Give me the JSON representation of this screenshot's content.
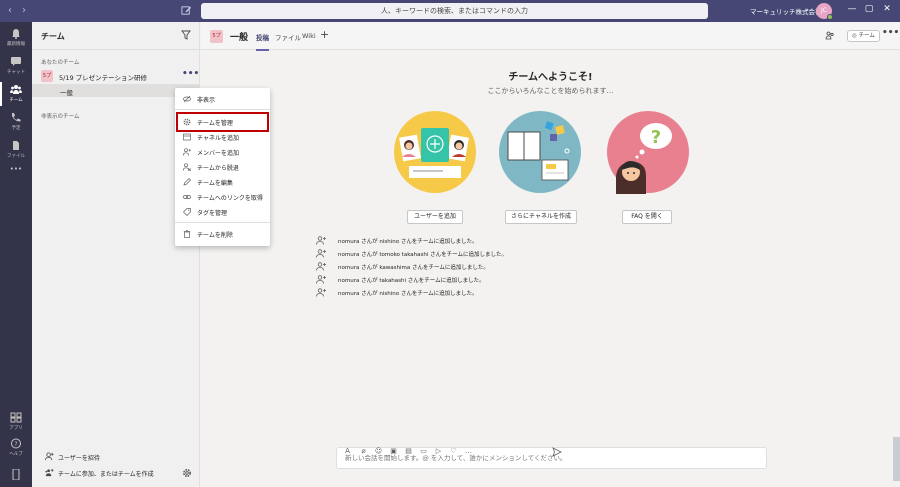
{
  "titlebar": {
    "search_placeholder": "人、キーワードの検索、またはコマンドの入力",
    "org_name": "マーキュリッチ株式会社",
    "org_chevron": "⌄",
    "avatar_initials": "JC",
    "back_glyph": "‹",
    "forward_glyph": "›",
    "minimize_glyph": "—",
    "maximize_glyph": "▢",
    "close_glyph": "✕"
  },
  "appbar": {
    "items": [
      {
        "label": "最新情報",
        "icon": "bell-icon"
      },
      {
        "label": "チャット",
        "icon": "chat-icon"
      },
      {
        "label": "チーム",
        "icon": "teams-icon"
      },
      {
        "label": "予定",
        "icon": "calendar-icon"
      },
      {
        "label": "ファイル",
        "icon": "file-icon"
      }
    ],
    "more_label": "•••",
    "apps_label": "アプリ",
    "help_label": "ヘルプ"
  },
  "teams_panel": {
    "title": "チーム",
    "your_teams_label": "あなたのチーム",
    "team_avatar": "5プ",
    "team_name": "5/19 プレゼンテーション研修",
    "team_more": "•••",
    "channel_name": "一般",
    "hidden_teams_label": "非表示のチーム",
    "invite_label": "ユーザーを招待",
    "join_create_label": "チームに参加、またはチームを作成"
  },
  "context_menu": {
    "items": [
      {
        "label": "非表示",
        "icon": "hide-icon"
      },
      {
        "label": "チームを管理",
        "icon": "gear-icon"
      },
      {
        "label": "チャネルを追加",
        "icon": "add-channel-icon"
      },
      {
        "label": "メンバーを追加",
        "icon": "add-member-icon"
      },
      {
        "label": "チームから脱退",
        "icon": "leave-icon"
      },
      {
        "label": "チームを編集",
        "icon": "edit-icon"
      },
      {
        "label": "チームへのリンクを取得",
        "icon": "link-icon"
      },
      {
        "label": "タグを管理",
        "icon": "tag-icon"
      },
      {
        "label": "チームを削除",
        "icon": "trash-icon"
      }
    ]
  },
  "channel": {
    "avatar": "5プ",
    "name": "一般",
    "tabs": [
      "投稿",
      "ファイル",
      "Wiki"
    ],
    "add_tab": "+",
    "team_pill": "◎ チーム",
    "more": "•••"
  },
  "welcome": {
    "title": "チームへようこそ!",
    "subtitle": "ここからいろんなことを始められます…",
    "buttons": [
      "ユーザーを追加",
      "さらにチャネルを作成",
      "FAQ を開く"
    ]
  },
  "activity": [
    {
      "actor": "nomura",
      "text": "nomura さんが nishino さんをチームに追加しました。"
    },
    {
      "actor": "nomura",
      "text": "nomura さんが tomoko takahashi さんをチームに追加しました。"
    },
    {
      "actor": "nomura",
      "text": "nomura さんが kawashima さんをチームに追加しました。"
    },
    {
      "actor": "nomura",
      "text": "nomura さんが takahashi さんをチームに追加しました。"
    },
    {
      "actor": "nomura",
      "text": "nomura さんが nishino さんをチームに追加しました。"
    }
  ],
  "composer": {
    "placeholder": "新しい会話を開始します。@ を入力して、誰かにメンションしてください。"
  },
  "colors": {
    "titlebar": "#464775",
    "appbar": "#33344a",
    "accent": "#6264a7",
    "highlight": "#c00000",
    "illus_yellow": "#f7c948",
    "illus_teal": "#7fb8c4",
    "illus_pink": "#e8808f"
  }
}
